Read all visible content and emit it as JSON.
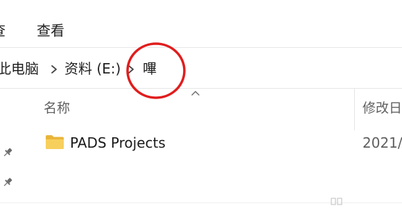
{
  "menubar": {
    "truncated_label": "查",
    "view_label": "查看"
  },
  "address": {
    "crumbs": [
      "此电脑",
      "资料 (E:)",
      "嗶"
    ]
  },
  "columns": {
    "name": "名称",
    "modified": "修改日"
  },
  "files": [
    {
      "name": "PADS Projects",
      "modified": "2021/",
      "icon": "folder-icon"
    }
  ],
  "colors": {
    "highlight_ring": "#e11d1d",
    "folder": "#f5c242"
  },
  "icons": {
    "separator": "chevron-right-icon",
    "pin": "pin-icon",
    "sort": "sort-ascending-icon"
  }
}
